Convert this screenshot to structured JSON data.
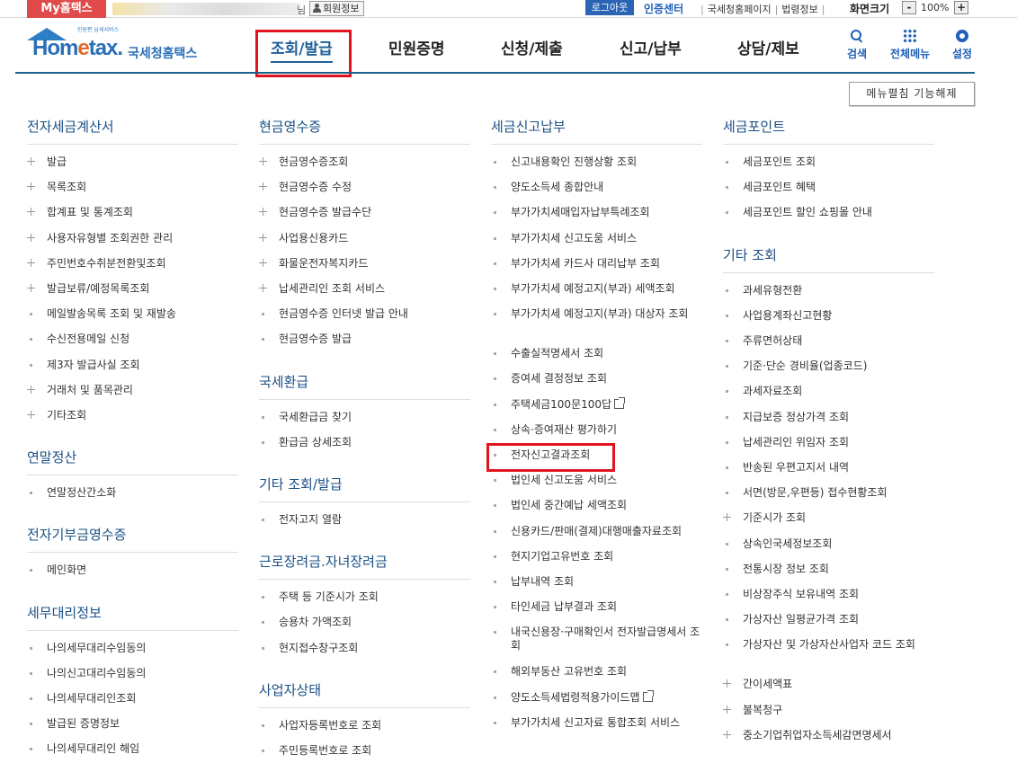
{
  "topbar": {
    "my_hometax": "My홈택스",
    "user_suffix": "님",
    "member_info": "회원정보",
    "logout": "로그아웃",
    "cert_center": "인증센터",
    "links": [
      "국세청홈페이지",
      "법령정보"
    ],
    "zoom_label": "화면크기",
    "zoom_minus": "-",
    "zoom_value": "100%",
    "zoom_plus": "+"
  },
  "header": {
    "logo_tag": "민원편 납세서비스",
    "logo_brand_1": "Hom",
    "logo_brand_e": "e",
    "logo_brand_2": "tax.",
    "logo_korean": "국세청홈택스",
    "nav": [
      "조회/발급",
      "민원증명",
      "신청/제출",
      "신고/납부",
      "상담/제보"
    ],
    "tools": {
      "search": "검색",
      "all_menu": "전체메뉴",
      "settings": "설정"
    },
    "icons": {
      "search": "search-icon",
      "all_menu": "grid-icon",
      "settings": "gear-icon"
    },
    "accent_color": "#1d5f9a",
    "highlight_color": "#e0141e"
  },
  "menu_toggle": "메뉴펼침 기능해제",
  "columns": [
    {
      "sections": [
        {
          "title": "전자세금계산서",
          "items": [
            {
              "label": "발급",
              "type": "plus"
            },
            {
              "label": "목록조회",
              "type": "plus"
            },
            {
              "label": "합계표 및 통계조회",
              "type": "plus"
            },
            {
              "label": "사용자유형별 조회권한 관리",
              "type": "plus"
            },
            {
              "label": "주민번호수취분전환및조회",
              "type": "plus"
            },
            {
              "label": "발급보류/예정목록조회",
              "type": "plus"
            },
            {
              "label": "메일발송목록 조회 및 재발송",
              "type": "dot"
            },
            {
              "label": "수신전용메일 신청",
              "type": "dot"
            },
            {
              "label": "제3자 발급사실 조회",
              "type": "dot"
            },
            {
              "label": "거래처 및 품목관리",
              "type": "plus"
            },
            {
              "label": "기타조회",
              "type": "plus"
            }
          ]
        },
        {
          "title": "연말정산",
          "items": [
            {
              "label": "연말정산간소화",
              "type": "dot"
            }
          ]
        },
        {
          "title": "전자기부금영수증",
          "items": [
            {
              "label": "메인화면",
              "type": "dot"
            }
          ]
        },
        {
          "title": "세무대리정보",
          "items": [
            {
              "label": "나의세무대리수임동의",
              "type": "dot"
            },
            {
              "label": "나의신고대리수임동의",
              "type": "dot"
            },
            {
              "label": "나의세무대리인조회",
              "type": "dot"
            },
            {
              "label": "발급된 증명정보",
              "type": "dot"
            },
            {
              "label": "나의세무대리인 해임",
              "type": "dot"
            }
          ]
        }
      ]
    },
    {
      "sections": [
        {
          "title": "현금영수증",
          "items": [
            {
              "label": "현금영수증조회",
              "type": "plus"
            },
            {
              "label": "현금영수증 수정",
              "type": "plus"
            },
            {
              "label": "현금영수증 발급수단",
              "type": "plus"
            },
            {
              "label": "사업용신용카드",
              "type": "plus"
            },
            {
              "label": "화물운전자복지카드",
              "type": "plus"
            },
            {
              "label": "납세관리인 조회 서비스",
              "type": "plus"
            },
            {
              "label": "현금영수증 인터넷 발급 안내",
              "type": "dot"
            },
            {
              "label": "현금영수증 발급",
              "type": "dot"
            }
          ]
        },
        {
          "title": "국세환급",
          "items": [
            {
              "label": "국세환급금 찾기",
              "type": "dot"
            },
            {
              "label": "환급금 상세조회",
              "type": "dot"
            }
          ]
        },
        {
          "title": "기타 조회/발급",
          "items": [
            {
              "label": "전자고지 열람",
              "type": "dot"
            }
          ]
        },
        {
          "title": "근로장려금.자녀장려금",
          "items": [
            {
              "label": "주택 등 기준시가 조회",
              "type": "dot"
            },
            {
              "label": "승용차 가액조회",
              "type": "dot"
            },
            {
              "label": "현지접수창구조회",
              "type": "dot"
            }
          ]
        },
        {
          "title": "사업자상태",
          "items": [
            {
              "label": "사업자등록번호로 조회",
              "type": "dot"
            },
            {
              "label": "주민등록번호로 조회",
              "type": "dot"
            }
          ]
        }
      ]
    },
    {
      "sections": [
        {
          "title": "세금신고납부",
          "items": [
            {
              "label": "신고내용확인 진행상황 조회",
              "type": "dot"
            },
            {
              "label": "양도소득세 종합안내",
              "type": "dot"
            },
            {
              "label": "부가가치세매입자납부특례조회",
              "type": "dot"
            },
            {
              "label": "부가가치세 신고도움 서비스",
              "type": "dot"
            },
            {
              "label": "부가가치세 카드사 대리납부 조회",
              "type": "dot"
            },
            {
              "label": "부가가치세 예정고지(부과) 세액조회",
              "type": "dot"
            },
            {
              "label": "부가가치세 예정고지(부과) 대상자 조회",
              "type": "dot",
              "wrap": true
            },
            {
              "label": "수출실적명세서 조회",
              "type": "dot"
            },
            {
              "label": "증여세 결정정보 조회",
              "type": "dot"
            },
            {
              "label": "주택세금100문100답",
              "type": "dot",
              "external": true
            },
            {
              "label": "상속·증여재산 평가하기",
              "type": "dot"
            },
            {
              "label": "전자신고결과조회",
              "type": "dot"
            },
            {
              "label": "법인세 신고도움 서비스",
              "type": "dot"
            },
            {
              "label": "법인세 중간예납 세액조회",
              "type": "dot"
            },
            {
              "label": "신용카드/판매(결제)대행매출자료조회",
              "type": "dot"
            },
            {
              "label": "현지기업고유번호 조회",
              "type": "dot"
            },
            {
              "label": "납부내역 조회",
              "type": "dot"
            },
            {
              "label": "타인세금 납부결과 조회",
              "type": "dot"
            },
            {
              "label": "내국신용장·구매확인서 전자발급명세서 조회",
              "type": "dot",
              "wrap": true
            },
            {
              "label": "해외부동산 고유번호 조회",
              "type": "dot"
            },
            {
              "label": "양도소득세법령적용가이드맵",
              "type": "dot",
              "external": true
            },
            {
              "label": "부가가치세 신고자료 통합조회 서비스",
              "type": "dot"
            }
          ]
        }
      ]
    },
    {
      "sections": [
        {
          "title": "세금포인트",
          "items": [
            {
              "label": "세금포인트 조회",
              "type": "dot"
            },
            {
              "label": "세금포인트 혜택",
              "type": "dot"
            },
            {
              "label": "세금포인트 할인 쇼핑몰 안내",
              "type": "dot"
            }
          ]
        },
        {
          "title": "기타 조회",
          "items": [
            {
              "label": "과세유형전환",
              "type": "dot"
            },
            {
              "label": "사업용계좌신고현황",
              "type": "dot"
            },
            {
              "label": "주류면허상태",
              "type": "dot"
            },
            {
              "label": "기준·단순 경비율(업종코드)",
              "type": "dot"
            },
            {
              "label": "과세자료조회",
              "type": "dot"
            },
            {
              "label": "지급보증 정상가격 조회",
              "type": "dot"
            },
            {
              "label": "납세관리인 위임자 조회",
              "type": "dot"
            },
            {
              "label": "반송된 우편고지서 내역",
              "type": "dot"
            },
            {
              "label": "서면(방문,우편등) 접수현황조회",
              "type": "dot"
            },
            {
              "label": "기준시가 조회",
              "type": "plus"
            },
            {
              "label": "상속인국세정보조회",
              "type": "dot"
            },
            {
              "label": "전통시장 정보 조회",
              "type": "dot"
            },
            {
              "label": "비상장주식 보유내역 조회",
              "type": "dot"
            },
            {
              "label": "가상자산 일평균가격 조회",
              "type": "dot"
            },
            {
              "label": "가상자산 및 가상자산사업자 코드 조회",
              "type": "dot",
              "wrap": true
            },
            {
              "label": "간이세액표",
              "type": "plus"
            },
            {
              "label": "불복청구",
              "type": "plus"
            },
            {
              "label": "중소기업취업자소득세감면명세서",
              "type": "plus"
            }
          ]
        }
      ]
    }
  ]
}
